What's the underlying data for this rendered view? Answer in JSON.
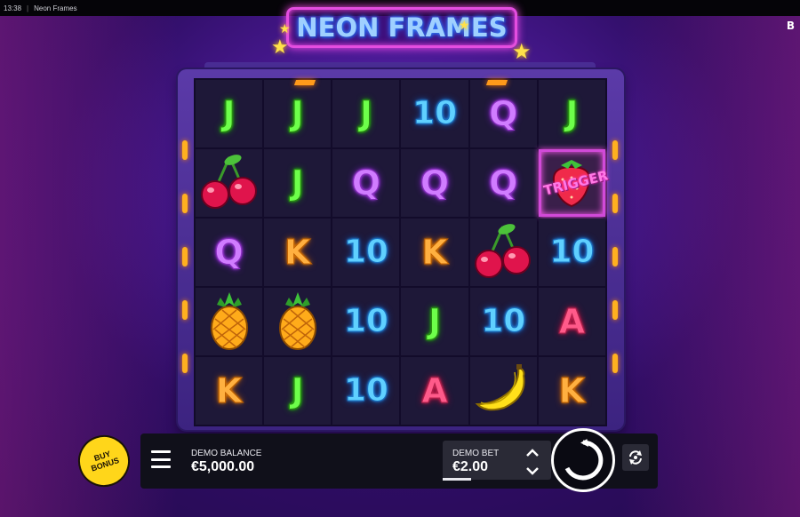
{
  "statusbar": {
    "time": "13:38",
    "app_title": "Neon Frames"
  },
  "corner_badge": "B",
  "logo": {
    "text": "NEON FRAMES"
  },
  "grid": {
    "rows": [
      [
        {
          "sym": "J"
        },
        {
          "sym": "J"
        },
        {
          "sym": "J"
        },
        {
          "sym": "10"
        },
        {
          "sym": "Q"
        },
        {
          "sym": "J"
        }
      ],
      [
        {
          "sym": "cherry"
        },
        {
          "sym": "J"
        },
        {
          "sym": "Q"
        },
        {
          "sym": "Q"
        },
        {
          "sym": "Q"
        },
        {
          "sym": "strawberry-trigger"
        }
      ],
      [
        {
          "sym": "Q"
        },
        {
          "sym": "K"
        },
        {
          "sym": "10"
        },
        {
          "sym": "K"
        },
        {
          "sym": "cherry"
        },
        {
          "sym": "10"
        }
      ],
      [
        {
          "sym": "pineapple"
        },
        {
          "sym": "pineapple"
        },
        {
          "sym": "10"
        },
        {
          "sym": "J"
        },
        {
          "sym": "10"
        },
        {
          "sym": "A"
        }
      ],
      [
        {
          "sym": "K"
        },
        {
          "sym": "J"
        },
        {
          "sym": "10"
        },
        {
          "sym": "A"
        },
        {
          "sym": "banana"
        },
        {
          "sym": "K"
        }
      ]
    ],
    "trigger_label": "TRIGGER"
  },
  "controls": {
    "buy_bonus_label": "BUY BONUS",
    "balance_label": "DEMO BALANCE",
    "balance_value": "€5,000.00",
    "bet_label": "DEMO BET",
    "bet_value": "€2.00"
  },
  "colors": {
    "accent_pink": "#e44de0",
    "accent_yellow": "#ffd61a",
    "background": "#2a0a52"
  }
}
